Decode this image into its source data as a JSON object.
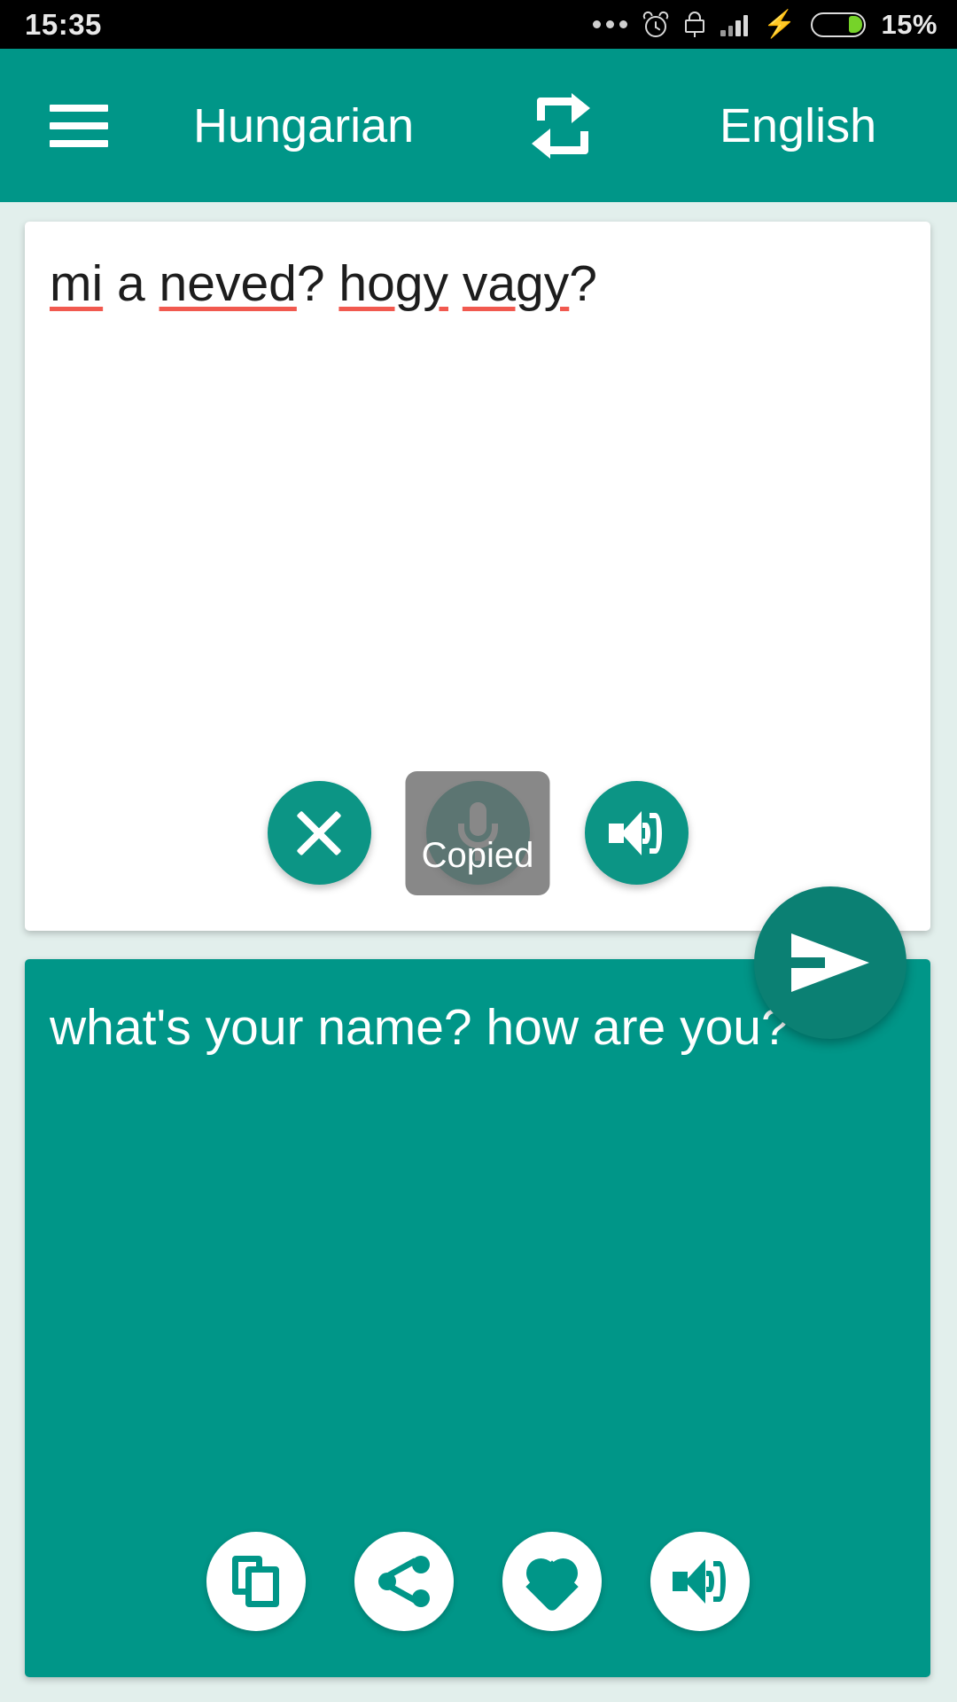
{
  "status_bar": {
    "clock": "15:35",
    "battery_percent": "15%",
    "icons": [
      "more-dots-icon",
      "alarm-icon",
      "lock-icon",
      "signal-icon",
      "charging-bolt-icon",
      "battery-icon"
    ]
  },
  "app_bar": {
    "menu_label": "menu",
    "source_language": "Hungarian",
    "target_language": "English",
    "swap_label": "swap languages"
  },
  "input_card": {
    "text_segments": [
      {
        "text": "mi",
        "misspelled": true
      },
      {
        "text": " ",
        "misspelled": false
      },
      {
        "text": "a",
        "misspelled": false
      },
      {
        "text": " ",
        "misspelled": false
      },
      {
        "text": "neved",
        "misspelled": true
      },
      {
        "text": "? ",
        "misspelled": false
      },
      {
        "text": "hogy",
        "misspelled": true
      },
      {
        "text": " ",
        "misspelled": false
      },
      {
        "text": "vagy",
        "misspelled": true
      },
      {
        "text": "?",
        "misspelled": false
      }
    ],
    "full_text": "mi a neved? hogy vagy?",
    "actions": [
      {
        "name": "clear-button",
        "icon": "close-icon",
        "label": "Clear"
      },
      {
        "name": "microphone-button",
        "icon": "microphone-icon",
        "label": "Speak"
      },
      {
        "name": "listen-source-button",
        "icon": "speaker-icon",
        "label": "Listen"
      }
    ],
    "toast": "Copied"
  },
  "send_button": {
    "icon": "send-icon",
    "label": "Translate"
  },
  "output_card": {
    "text": "what's your name? how are you?",
    "actions": [
      {
        "name": "copy-button",
        "icon": "copy-icon",
        "label": "Copy"
      },
      {
        "name": "share-button",
        "icon": "share-icon",
        "label": "Share"
      },
      {
        "name": "favorite-button",
        "icon": "heart-icon",
        "label": "Favorite"
      },
      {
        "name": "listen-result-button",
        "icon": "speaker-icon",
        "label": "Listen"
      }
    ]
  },
  "colors": {
    "primary_teal": "#009688",
    "dark_teal": "#0b8073",
    "button_teal": "#0c9585",
    "page_background": "#e2efec",
    "spellcheck_red": "#f1594f",
    "battery_green": "#76d329",
    "status_bar_bg": "#000000"
  }
}
